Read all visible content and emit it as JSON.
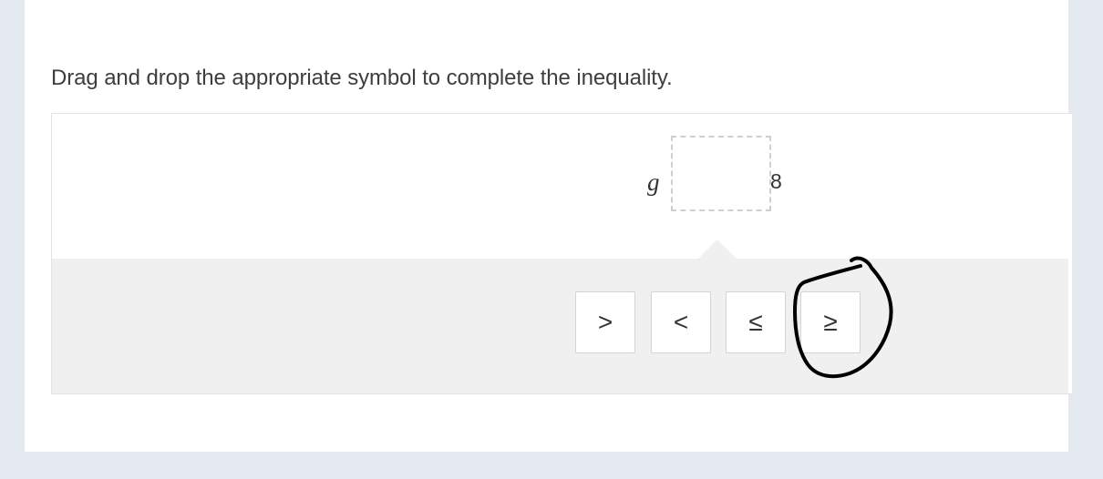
{
  "question": {
    "prompt": "Drag and drop the appropriate symbol to complete the inequality."
  },
  "expression": {
    "variable": "g",
    "constant": "8",
    "blank_value": ""
  },
  "symbols": [
    ">",
    "<",
    "≤",
    "≥"
  ],
  "annotation": {
    "type": "hand-drawn circle",
    "circled_symbol": "≥",
    "color": "#000000"
  },
  "colors": {
    "page_background": "#e4e9f0",
    "tray_background": "#f0f0f0",
    "drop_zone_border": "#cfcfcf"
  }
}
